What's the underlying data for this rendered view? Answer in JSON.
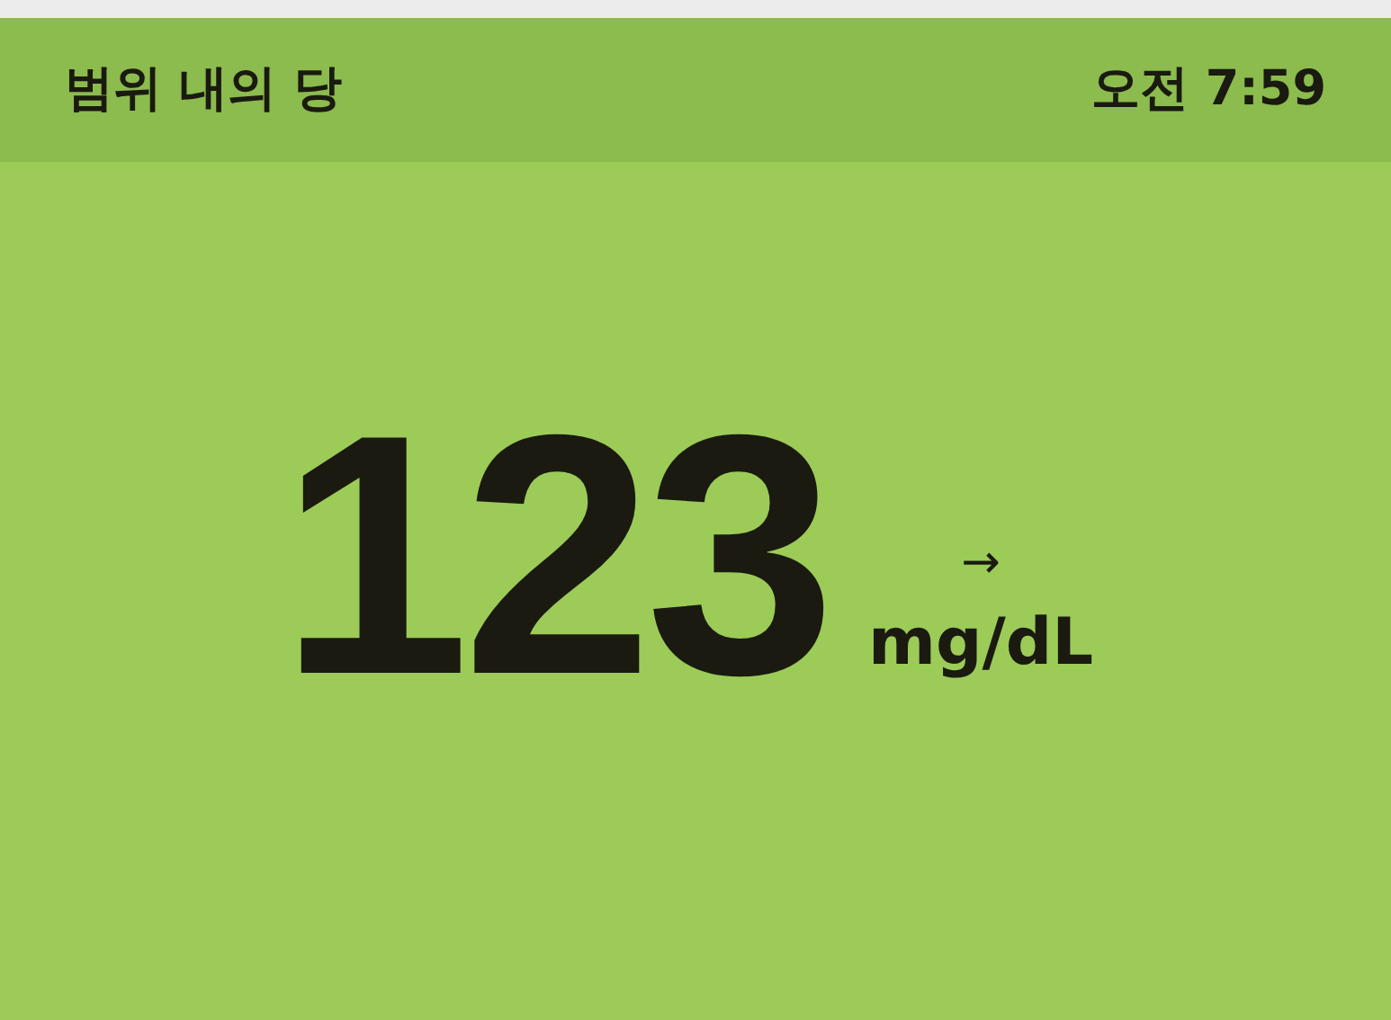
{
  "header": {
    "title": "범위 내의 당",
    "time": "오전 7:59"
  },
  "reading": {
    "value": "123",
    "trend": "→",
    "unit": "mg/dL"
  }
}
